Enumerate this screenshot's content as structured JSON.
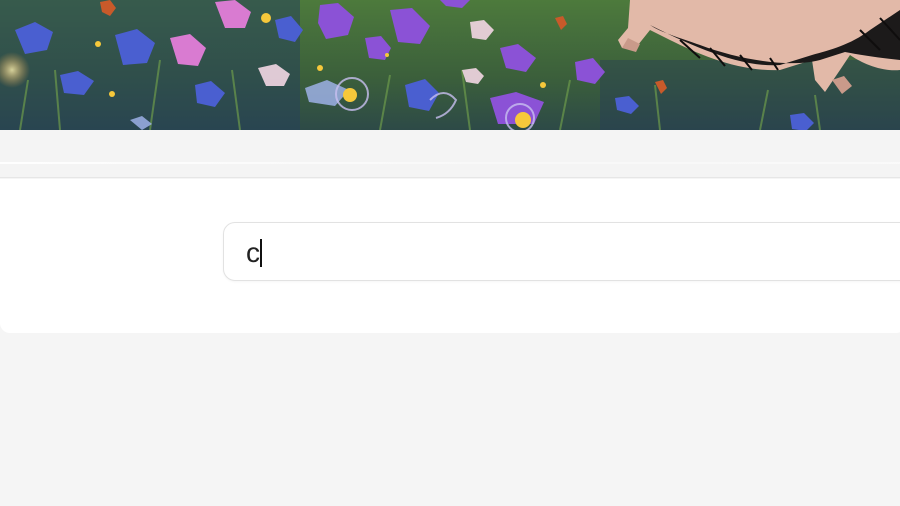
{
  "banner": {
    "illustration": "wildflower-meadow-with-hedgehog",
    "colors": {
      "grass": "#3f6a3a",
      "grass_dark": "#26462f",
      "meadow_blue": "#3d5aa8",
      "purple": "#8b52d6",
      "pink": "#d97bd1",
      "yellow": "#f6c83b",
      "hedgehog_skin": "#e2b9a8",
      "hedgehog_spines": "#1c1a1a"
    }
  },
  "search": {
    "value": "c",
    "caret_visible": true
  },
  "colors": {
    "page_bg": "#f5f5f5",
    "panel_bg": "#ffffff",
    "input_border": "#e2e2e2",
    "text": "#222222"
  }
}
